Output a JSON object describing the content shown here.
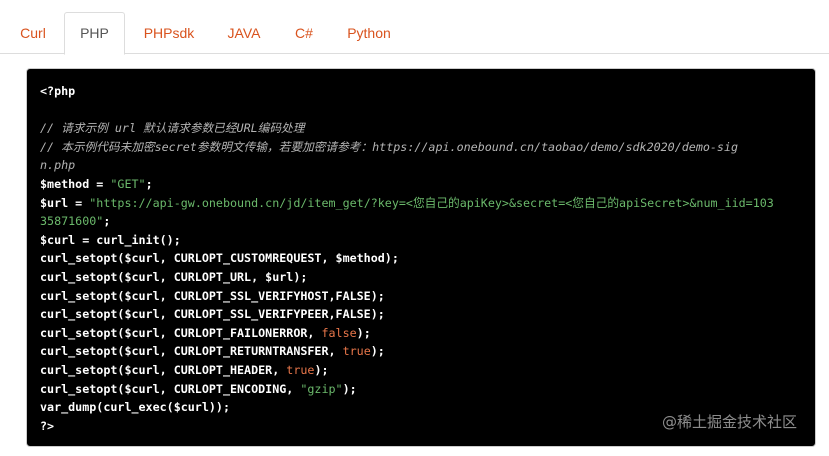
{
  "tabs": [
    {
      "label": "Curl"
    },
    {
      "label": "PHP",
      "active": true
    },
    {
      "label": "PHPsdk"
    },
    {
      "label": "JAVA"
    },
    {
      "label": "C#"
    },
    {
      "label": "Python"
    }
  ],
  "code": {
    "lines": [
      "<?php",
      "",
      "// 请求示例 url 默认请求参数已经URL编码处理",
      "// 本示例代码未加密secret参数明文传输，若要加密请参考：https://api.onebound.cn/taobao/demo/sdk2020/demo-sig",
      "n.php",
      "$method = ",
      "\"GET\"",
      ";",
      "$url = ",
      "\"https://api-gw.onebound.cn/jd/item_get/?key=<您自己的apiKey>&secret=<您自己的apiSecret>&num_iid=103",
      "35871600\"",
      ";",
      "$curl = curl_init();",
      "curl_setopt($curl, CURLOPT_CUSTOMREQUEST, $method);",
      "curl_setopt($curl, CURLOPT_URL, $url);",
      "curl_setopt($curl, CURLOPT_SSL_VERIFYHOST,FALSE);",
      "curl_setopt($curl, CURLOPT_SSL_VERIFYPEER,FALSE);",
      "curl_setopt($curl, CURLOPT_FAILONERROR, ",
      "false",
      ");",
      "curl_setopt($curl, CURLOPT_RETURNTRANSFER, ",
      "true",
      ");",
      "curl_setopt($curl, CURLOPT_HEADER, ",
      "true",
      ");",
      "curl_setopt($curl, CURLOPT_ENCODING, ",
      "\"gzip\"",
      ");",
      "var_dump(curl_exec($curl));",
      "?>"
    ]
  },
  "watermark": "@稀土掘金技术社区"
}
